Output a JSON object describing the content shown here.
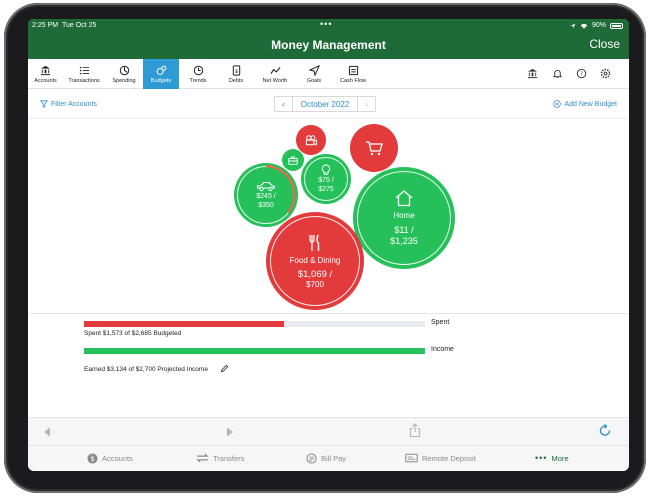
{
  "status": {
    "time": "2:25 PM",
    "date": "Tue Oct 25",
    "battery": "90%"
  },
  "header": {
    "title": "Money Management",
    "close_label": "Close"
  },
  "toolbar": {
    "items": [
      {
        "label": "Accounts",
        "icon": "bank-icon"
      },
      {
        "label": "Transactions",
        "icon": "list-icon"
      },
      {
        "label": "Spending",
        "icon": "spending-icon"
      },
      {
        "label": "Budgets",
        "icon": "budgets-icon",
        "active": true
      },
      {
        "label": "Trends",
        "icon": "clock-icon"
      },
      {
        "label": "Debts",
        "icon": "debts-icon"
      },
      {
        "label": "Net Worth",
        "icon": "net-worth-icon"
      },
      {
        "label": "Goals",
        "icon": "goals-icon"
      },
      {
        "label": "Cash Flow",
        "icon": "cash-flow-icon"
      }
    ]
  },
  "subbar": {
    "filter_label": "Filter Accounts",
    "month": "October 2022",
    "add_label": "Add New Budget"
  },
  "budgets": {
    "auto": {
      "spent": "$245 /",
      "budget": "$350"
    },
    "utilities": {
      "spent": "$75 /",
      "budget": "$275"
    },
    "home": {
      "name": "Home",
      "spent": "$11 /",
      "budget": "$1,235"
    },
    "food": {
      "name": "Food & Dining",
      "spent": "$1,069 /",
      "budget": "$700"
    }
  },
  "summary": {
    "spent_label": "Spent",
    "spent_caption": "Spent $1,573 of $2,685 Budgeted",
    "spent_fraction": 0.586,
    "income_label": "Income",
    "income_caption": "Earned $3,134 of $2,700 Projected Income",
    "income_fraction": 1.0
  },
  "colors": {
    "header": "#1e6b38",
    "accent": "#2e9bd6",
    "green": "#25c05a",
    "red": "#e33b3b"
  },
  "tabbar": {
    "accounts": "Accounts",
    "transfers": "Transfers",
    "bill_pay": "Bill Pay",
    "remote_deposit": "Remote Deposit",
    "more": "More"
  }
}
